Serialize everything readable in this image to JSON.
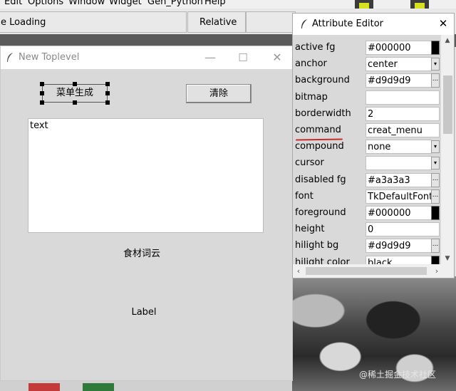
{
  "menubar": {
    "items": [
      "Edit",
      "Options",
      "Window",
      "Widget",
      "Gen_Python",
      "Help"
    ]
  },
  "toolbar": {
    "loading_label": "e Loading",
    "relative_label": "Relative"
  },
  "toplevel": {
    "title": "New Toplevel",
    "minimize_glyph": "—",
    "maximize_glyph": "☐",
    "close_glyph": "✕",
    "menu_button_label": "菜单生成",
    "clear_button_label": "清除",
    "text_content": "text",
    "cloud_label": "食材词云",
    "label_text": "Label"
  },
  "attribute_editor": {
    "title": "Attribute Editor",
    "close_glyph": "✕",
    "rows": [
      {
        "name": "active fg",
        "value": "#000000",
        "control": "swatch"
      },
      {
        "name": "anchor",
        "value": "center",
        "control": "dropdown"
      },
      {
        "name": "background",
        "value": "#d9d9d9",
        "control": "dots"
      },
      {
        "name": "bitmap",
        "value": "",
        "control": "none"
      },
      {
        "name": "borderwidth",
        "value": "2",
        "control": "none"
      },
      {
        "name": "command",
        "value": "creat_menu",
        "control": "none"
      },
      {
        "name": "compound",
        "value": "none",
        "control": "dropdown"
      },
      {
        "name": "cursor",
        "value": "",
        "control": "dropdown"
      },
      {
        "name": "disabled fg",
        "value": "#a3a3a3",
        "control": "dots"
      },
      {
        "name": "font",
        "value": "TkDefaultFont",
        "control": "dots"
      },
      {
        "name": "foreground",
        "value": "#000000",
        "control": "swatch"
      },
      {
        "name": "height",
        "value": "0",
        "control": "none"
      },
      {
        "name": "hilight bg",
        "value": "#d9d9d9",
        "control": "dots"
      },
      {
        "name": "hilight color",
        "value": "black",
        "control": "swatch"
      }
    ]
  },
  "watermark": "@稀土掘金技术社区",
  "colors": {
    "accent_underline": "#cc2a2a",
    "widget_bg": "#d9d9d9"
  }
}
